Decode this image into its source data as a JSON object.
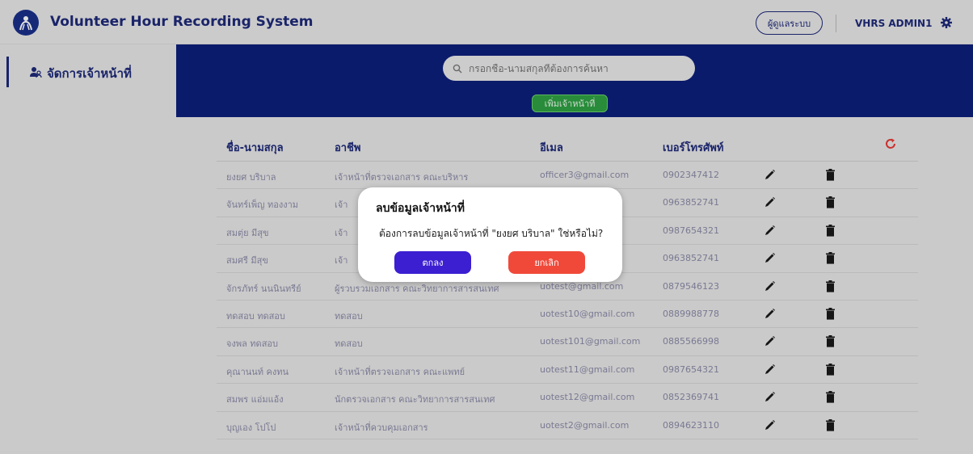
{
  "app": {
    "title": "Volunteer Hour Recording System"
  },
  "topbar": {
    "role_label": "ผู้ดูแลระบบ",
    "username": "VHRS ADMIN1"
  },
  "sidebar": {
    "items": [
      {
        "label": "จัดการเจ้าหน้าที่"
      }
    ]
  },
  "search": {
    "placeholder": "กรอกชื่อ-นามสกุลที่ต้องการค้นหา"
  },
  "toolbar": {
    "add_label": "เพิ่มเจ้าหน้าที่"
  },
  "table": {
    "headers": [
      "ชื่อ-นามสกุล",
      "อาชีพ",
      "อีเมล",
      "เบอร์โทรศัพท์"
    ],
    "rows": [
      {
        "name": "ยงยศ บริบาล",
        "job": "เจ้าหน้าที่ตรวจเอกสาร คณะบริหาร",
        "email": "officer3@gmail.com",
        "phone": "0902347412"
      },
      {
        "name": "จันทร์เพ็ญ ทองงาม",
        "job": "เจ้า",
        "email": "",
        "phone": "0963852741"
      },
      {
        "name": "สมตุ่ย มีสุข",
        "job": "เจ้า",
        "email": "",
        "phone": "0987654321"
      },
      {
        "name": "สมศรี มีสุข",
        "job": "เจ้า",
        "email": "",
        "phone": "0963852741"
      },
      {
        "name": "จักรภัทร์ นนนินทรีย์",
        "job": "ผู้รวบรวมเอกสาร คณะวิทยาการสารสนเทศ",
        "email": "uotest@gmail.com",
        "phone": "0879546123"
      },
      {
        "name": "ทดสอบ ทดสอบ",
        "job": "ทดสอบ",
        "email": "uotest10@gmail.com",
        "phone": "0889988778"
      },
      {
        "name": "จงพล ทดสอบ",
        "job": "ทดสอบ",
        "email": "uotest101@gmail.com",
        "phone": "0885566998"
      },
      {
        "name": "คุณานนท์ คงทน",
        "job": "เจ้าหน้าที่ตรวจเอกสาร คณะแพทย์",
        "email": "uotest11@gmail.com",
        "phone": "0987654321"
      },
      {
        "name": "สมพร แอ่มแอ้ง",
        "job": "นักตรวจเอกสาร คณะวิทยาการสารสนเทศ",
        "email": "uotest12@gmail.com",
        "phone": "0852369741"
      },
      {
        "name": "บุญเอง โปโป",
        "job": "เจ้าหน้าที่ควบคุมเอกสาร",
        "email": "uotest2@gmail.com",
        "phone": "0894623110"
      }
    ]
  },
  "modal": {
    "title": "ลบข้อมูลเจ้าหน้าที่",
    "message": "ต้องการลบข้อมูลเจ้าหน้าที่ \"ยงยศ บริบาล\" ใช่หรือไม่?",
    "confirm_label": "ตกลง",
    "cancel_label": "ยกเลิก"
  },
  "colors": {
    "brand": "#1e2a78",
    "band": "#0d1f7a",
    "confirm": "#3b1fd1",
    "cancel": "#f0493a",
    "add": "#2ea043",
    "refresh": "#e53935"
  },
  "icons": [
    "logo-icon",
    "people-icon",
    "search-icon",
    "gear-icon",
    "refresh-icon",
    "edit-icon",
    "trash-icon"
  ]
}
